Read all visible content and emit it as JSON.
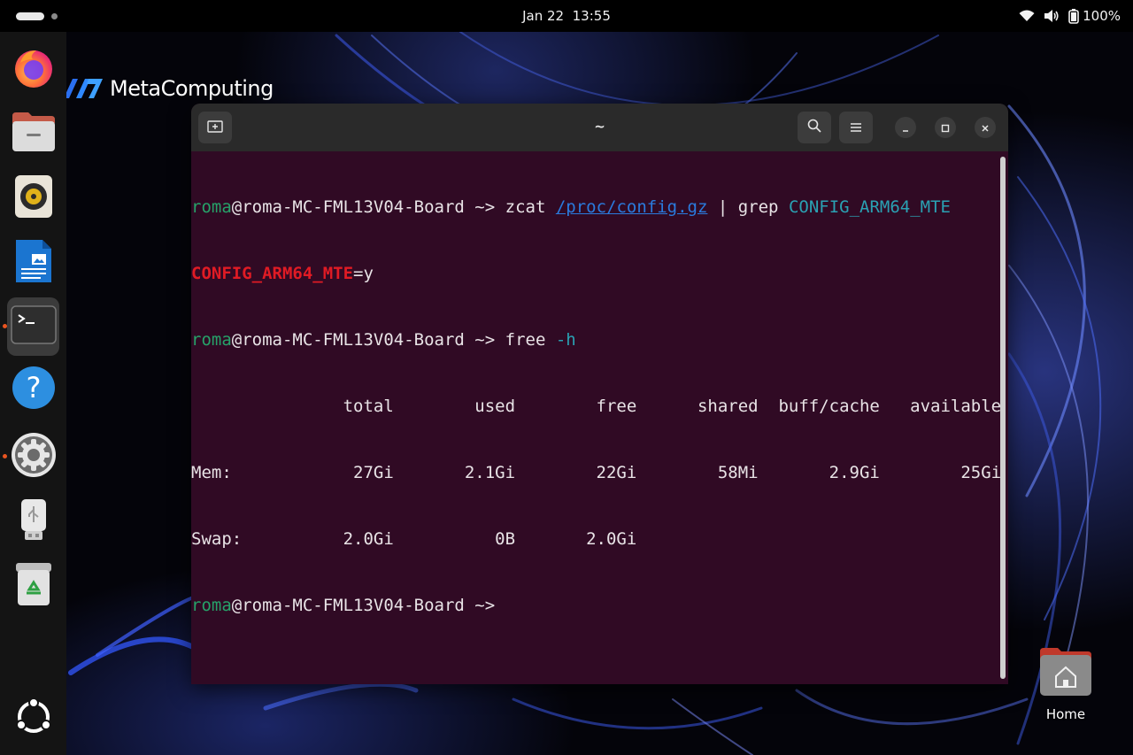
{
  "topbar": {
    "date": "Jan 22",
    "time": "13:55",
    "battery": "100%",
    "icons": [
      "wifi-icon",
      "volume-icon",
      "battery-icon"
    ]
  },
  "dock": {
    "apps": [
      {
        "name": "firefox-icon",
        "running": false
      },
      {
        "name": "files-icon",
        "running": false
      },
      {
        "name": "rhythmbox-icon",
        "running": false
      },
      {
        "name": "libreoffice-writer-icon",
        "running": false
      },
      {
        "name": "terminal-icon",
        "running": true,
        "active": true
      },
      {
        "name": "help-icon",
        "running": false
      },
      {
        "name": "settings-icon",
        "running": true
      },
      {
        "name": "usb-drive-icon",
        "running": false
      },
      {
        "name": "trash-icon",
        "running": false
      },
      {
        "name": "show-apps-icon",
        "running": false
      }
    ]
  },
  "logo": {
    "text": "MetaComputing"
  },
  "terminal": {
    "title": "~",
    "prompt_user": "roma",
    "prompt_host": "@roma-MC-FML13V04-Board ~> ",
    "cmd1": "zcat ",
    "cmd1_path": "/proc/config.gz",
    "cmd1_pipe": " | grep ",
    "cmd1_arg": "CONFIG_ARM64_MTE",
    "out1_match": "CONFIG_ARM64_MTE",
    "out1_rest": "=y",
    "cmd2": "free ",
    "cmd2_arg": "-h",
    "free_header": "               total        used        free      shared  buff/cache   available",
    "free_mem": "Mem:            27Gi       2.1Gi        22Gi        58Mi       2.9Gi        25Gi",
    "free_swap": "Swap:          2.0Gi          0B       2.0Gi"
  },
  "desktop": {
    "home_label": "Home"
  },
  "colors": {
    "terminal_bg": "#300a24",
    "prompt_green": "#26a269",
    "grep_match": "#e01b24",
    "arg_cyan": "#2aa1b3",
    "accent": "#e95420"
  }
}
